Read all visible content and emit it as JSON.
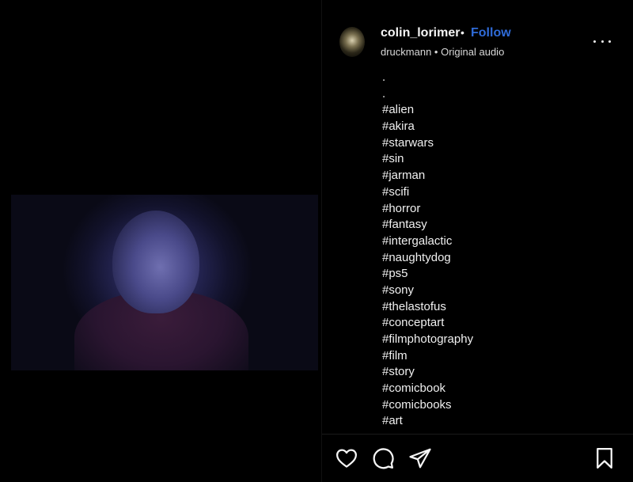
{
  "post": {
    "username": "colin_lorimer",
    "separator": "•",
    "follow_label": "Follow",
    "audio_line": "druckmann • Original audio",
    "caption_lines": [
      ".",
      ".",
      "#alien",
      "#akira",
      "#starwars",
      "#sin",
      "#jarman",
      "#scifi",
      "#horror",
      "#fantasy",
      "#intergalactic",
      "#naughtydog",
      "#ps5",
      "#sony",
      "#thelastofus",
      "#conceptart",
      "#filmphotography",
      "#film",
      "#story",
      "#comicbook",
      "#comicbooks",
      "#art"
    ]
  },
  "icons": {
    "more": "more-options-icon",
    "like": "heart-icon",
    "comment": "comment-icon",
    "share": "share-icon",
    "save": "bookmark-icon"
  },
  "colors": {
    "background": "#000000",
    "text": "#f5f5f5",
    "follow": "#2f6bd8"
  }
}
